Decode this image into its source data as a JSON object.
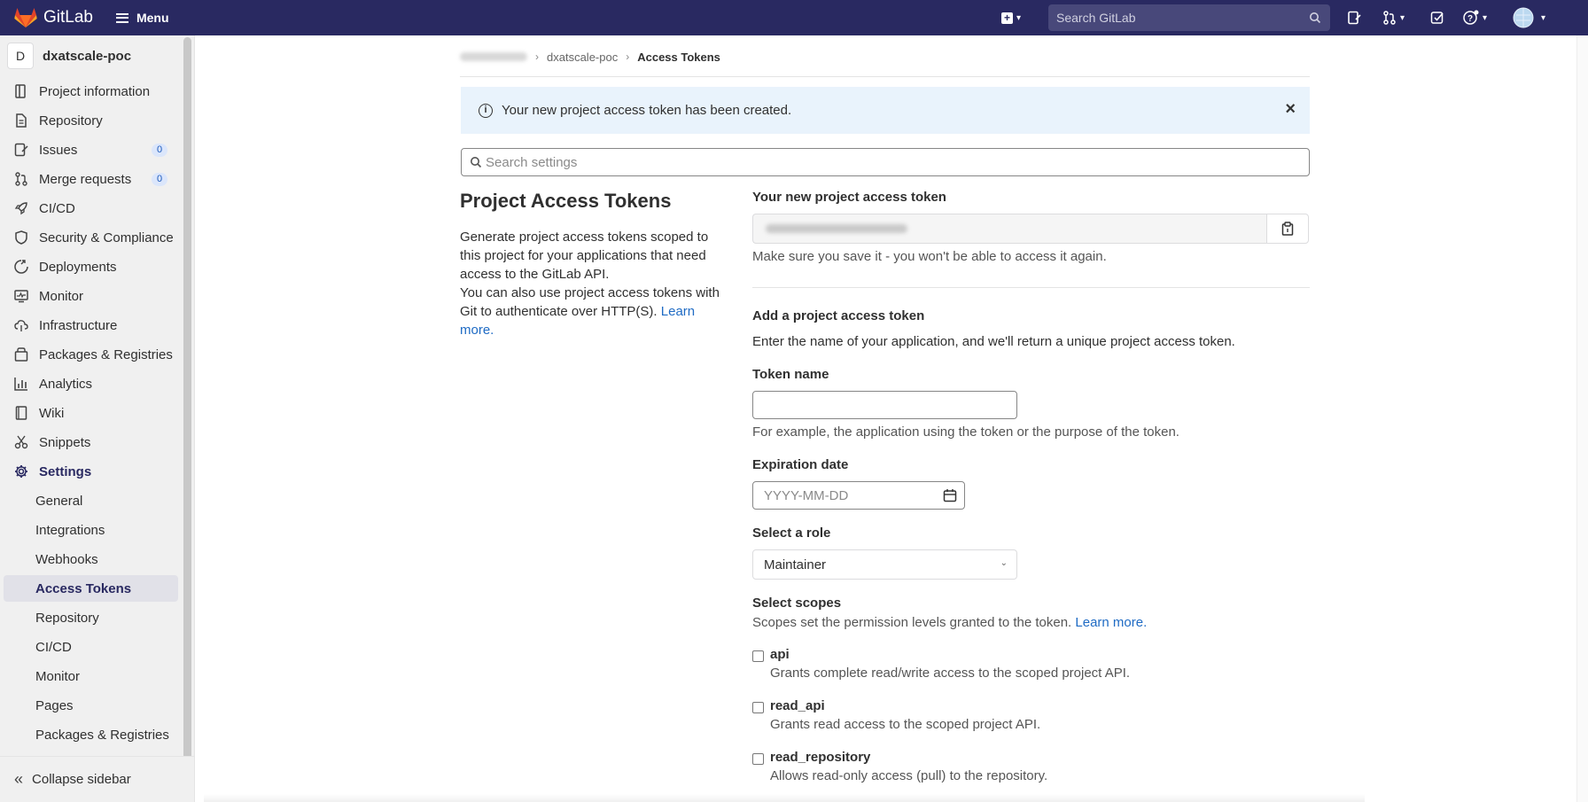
{
  "topbar": {
    "logo_text": "GitLab",
    "menu_label": "Menu",
    "search_placeholder": "Search GitLab",
    "icons": [
      "plus-square-icon",
      "issues-icon",
      "merge-request-icon",
      "todo-icon",
      "help-icon",
      "user-avatar"
    ]
  },
  "sidebar": {
    "project_initial": "D",
    "project_name": "dxatscale-poc",
    "items": [
      {
        "label": "Project information",
        "icon": "project-icon"
      },
      {
        "label": "Repository",
        "icon": "doc-icon"
      },
      {
        "label": "Issues",
        "icon": "issues-icon",
        "count": "0"
      },
      {
        "label": "Merge requests",
        "icon": "merge-request-icon",
        "count": "0"
      },
      {
        "label": "CI/CD",
        "icon": "rocket-icon"
      },
      {
        "label": "Security & Compliance",
        "icon": "shield-icon"
      },
      {
        "label": "Deployments",
        "icon": "deployments-icon"
      },
      {
        "label": "Monitor",
        "icon": "monitor-icon"
      },
      {
        "label": "Infrastructure",
        "icon": "cloud-icon"
      },
      {
        "label": "Packages & Registries",
        "icon": "package-icon"
      },
      {
        "label": "Analytics",
        "icon": "chart-icon"
      },
      {
        "label": "Wiki",
        "icon": "book-icon"
      },
      {
        "label": "Snippets",
        "icon": "snippet-icon"
      },
      {
        "label": "Settings",
        "icon": "gear-icon"
      }
    ],
    "settings_sub": [
      "General",
      "Integrations",
      "Webhooks",
      "Access Tokens",
      "Repository",
      "CI/CD",
      "Monitor",
      "Pages",
      "Packages & Registries"
    ],
    "active_sub": "Access Tokens",
    "collapse_label": "Collapse sidebar"
  },
  "breadcrumb": {
    "project": "dxatscale-poc",
    "current": "Access Tokens"
  },
  "alert": {
    "message": "Your new project access token has been created."
  },
  "settings_search": {
    "placeholder": "Search settings"
  },
  "section": {
    "title": "Project Access Tokens",
    "desc_1": "Generate project access tokens scoped to this project for your applications that need access to the GitLab API.",
    "desc_2": "You can also use project access tokens with Git to authenticate over HTTP(S).",
    "learn_more": "Learn more."
  },
  "new_token": {
    "label": "Your new project access token",
    "help": "Make sure you save it - you won't be able to access it again."
  },
  "add_token": {
    "title": "Add a project access token",
    "desc": "Enter the name of your application, and we'll return a unique project access token.",
    "name_label": "Token name",
    "name_value": "",
    "name_help": "For example, the application using the token or the purpose of the token.",
    "expiration_label": "Expiration date",
    "expiration_placeholder": "YYYY-MM-DD",
    "role_label": "Select a role",
    "role_value": "Maintainer",
    "scopes_label": "Select scopes",
    "scopes_desc": "Scopes set the permission levels granted to the token.",
    "scopes_learn_more": "Learn more.",
    "scopes": [
      {
        "name": "api",
        "desc": "Grants complete read/write access to the scoped project API.",
        "checked": false
      },
      {
        "name": "read_api",
        "desc": "Grants read access to the scoped project API.",
        "checked": false
      },
      {
        "name": "read_repository",
        "desc": "Allows read-only access (pull) to the repository.",
        "checked": false
      }
    ]
  },
  "colors": {
    "topbar": "#292961",
    "link": "#1f6bc4",
    "alert_bg": "#e9f3fc"
  }
}
